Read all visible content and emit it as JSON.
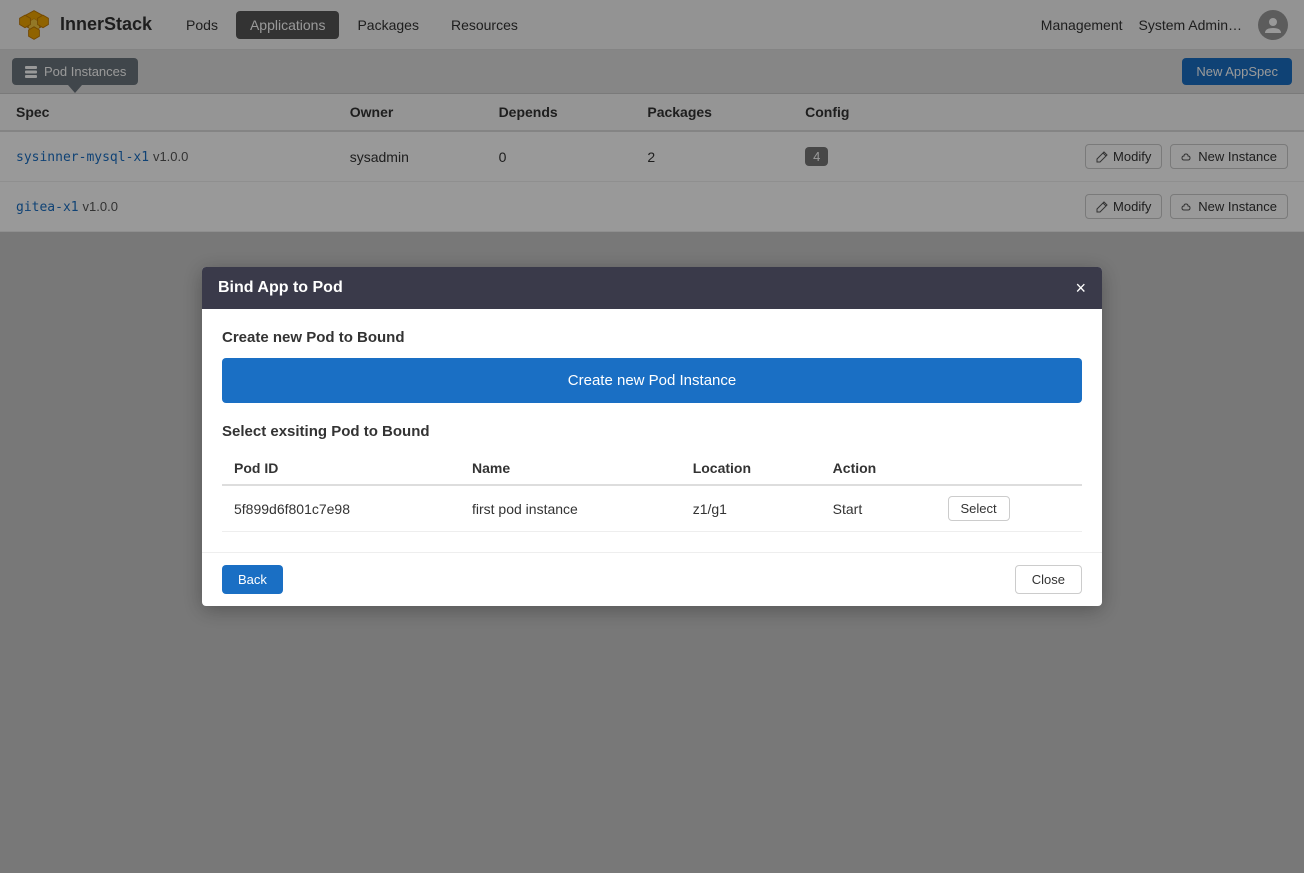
{
  "navbar": {
    "brand": "InnerStack",
    "links": [
      {
        "label": "Pods",
        "active": false
      },
      {
        "label": "Applications",
        "active": true
      },
      {
        "label": "Packages",
        "active": false
      },
      {
        "label": "Resources",
        "active": false
      }
    ],
    "right": {
      "management": "Management",
      "sysadmin": "System Admin…"
    }
  },
  "subtoolbar": {
    "pod_instances_label": "Pod Instances",
    "new_appspec_label": "New AppSpec"
  },
  "table": {
    "columns": [
      "Spec",
      "Owner",
      "Depends",
      "Packages",
      "Config"
    ],
    "rows": [
      {
        "spec_link": "sysinner-mysql-x1",
        "version": "v1.0.0",
        "owner": "sysadmin",
        "depends": "0",
        "packages": "2",
        "config": "4",
        "modify_label": "Modify",
        "new_instance_label": "New Instance"
      },
      {
        "spec_link": "gitea-x1",
        "version": "v1.0.0",
        "owner": "",
        "depends": "",
        "packages": "",
        "config": "",
        "modify_label": "Modify",
        "new_instance_label": "New Instance"
      }
    ]
  },
  "modal": {
    "title": "Bind App to Pod",
    "close_label": "×",
    "create_section_title": "Create new Pod to Bound",
    "create_btn_label": "Create new Pod Instance",
    "select_section_title": "Select exsiting Pod to Bound",
    "pod_table": {
      "columns": [
        "Pod ID",
        "Name",
        "Location",
        "Action"
      ],
      "rows": [
        {
          "pod_id": "5f899d6f801c7e98",
          "name": "first pod instance",
          "location": "z1/g1",
          "action": "Start",
          "select_label": "Select"
        }
      ]
    },
    "back_label": "Back",
    "close_footer_label": "Close"
  }
}
